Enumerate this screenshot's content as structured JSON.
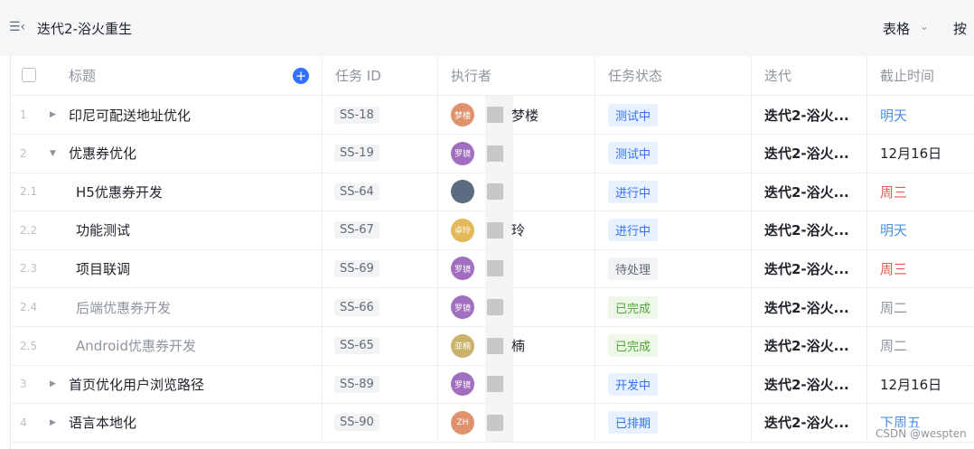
{
  "topbar": {
    "menu_icon": "☰‹",
    "sprint_title": "迭代2-浴火重生",
    "view_label": "表格",
    "view_chevron": "⌄",
    "group_label": "按"
  },
  "columns": {
    "title": "标题",
    "task_id": "任务 ID",
    "assignee": "执行者",
    "status": "任务状态",
    "iteration": "迭代",
    "due": "截止时间"
  },
  "rows": [
    {
      "num": "1",
      "arrow": "▶",
      "title": "印尼可配送地址优化",
      "indent": 0,
      "done": false,
      "id": "SS-18",
      "avatar_text": "梦楼",
      "avatar_color": "#e0926f",
      "assignee": "梦楼",
      "status": "测试中",
      "status_bg": "#e8f1ff",
      "status_fg": "#3370ff",
      "iteration": "迭代2-浴火...",
      "due": "明天",
      "due_color": "#4a90e2"
    },
    {
      "num": "2",
      "arrow": "▼",
      "title": "优惠券优化",
      "indent": 0,
      "done": false,
      "id": "SS-19",
      "avatar_text": "罗镜",
      "avatar_color": "#a16fbf",
      "assignee": "",
      "status": "测试中",
      "status_bg": "#e8f1ff",
      "status_fg": "#3370ff",
      "iteration": "迭代2-浴火...",
      "due": "12月16日",
      "due_color": "#1f2329"
    },
    {
      "num": "2.1",
      "arrow": "",
      "title": "H5优惠券开发",
      "indent": 1,
      "done": false,
      "id": "SS-64",
      "avatar_text": "",
      "avatar_color": "#5a6b82",
      "assignee": "",
      "status": "进行中",
      "status_bg": "#e8f1ff",
      "status_fg": "#3370ff",
      "iteration": "迭代2-浴火...",
      "due": "周三",
      "due_color": "#e05a4f"
    },
    {
      "num": "2.2",
      "arrow": "",
      "title": "功能测试",
      "indent": 1,
      "done": false,
      "id": "SS-67",
      "avatar_text": "卓玲",
      "avatar_color": "#e3b95a",
      "assignee": "玲",
      "status": "进行中",
      "status_bg": "#e8f1ff",
      "status_fg": "#3370ff",
      "iteration": "迭代2-浴火...",
      "due": "明天",
      "due_color": "#4a90e2"
    },
    {
      "num": "2.3",
      "arrow": "",
      "title": "项目联调",
      "indent": 1,
      "done": false,
      "id": "SS-69",
      "avatar_text": "罗镜",
      "avatar_color": "#a16fbf",
      "assignee": "",
      "status": "待处理",
      "status_bg": "#f2f3f5",
      "status_fg": "#646a73",
      "iteration": "迭代2-浴火...",
      "due": "周三",
      "due_color": "#e05a4f"
    },
    {
      "num": "2.4",
      "arrow": "",
      "title": "后端优惠券开发",
      "indent": 1,
      "done": true,
      "id": "SS-66",
      "avatar_text": "罗镜",
      "avatar_color": "#a16fbf",
      "assignee": "",
      "status": "已完成",
      "status_bg": "#eef8e8",
      "status_fg": "#52a33a",
      "iteration": "迭代2-浴火...",
      "due": "周二",
      "due_color": "#8f959e"
    },
    {
      "num": "2.5",
      "arrow": "",
      "title": "Android优惠券开发",
      "indent": 1,
      "done": true,
      "id": "SS-65",
      "avatar_text": "亚楠",
      "avatar_color": "#c9b36a",
      "assignee": "楠",
      "status": "已完成",
      "status_bg": "#eef8e8",
      "status_fg": "#52a33a",
      "iteration": "迭代2-浴火...",
      "due": "周二",
      "due_color": "#8f959e"
    },
    {
      "num": "3",
      "arrow": "▶",
      "title": "首页优化用户浏览路径",
      "indent": 0,
      "done": false,
      "id": "SS-89",
      "avatar_text": "罗镜",
      "avatar_color": "#a16fbf",
      "assignee": "",
      "status": "开发中",
      "status_bg": "#e8f1ff",
      "status_fg": "#3370ff",
      "iteration": "迭代2-浴火...",
      "due": "12月16日",
      "due_color": "#1f2329"
    },
    {
      "num": "4",
      "arrow": "▶",
      "title": "语言本地化",
      "indent": 0,
      "done": false,
      "id": "SS-90",
      "avatar_text": "ZH",
      "avatar_color": "#e0926f",
      "assignee": "",
      "status": "已排期",
      "status_bg": "#e8f1ff",
      "status_fg": "#3370ff",
      "iteration": "迭代2-浴火...",
      "due": "下周五",
      "due_color": "#4a90e2"
    }
  ],
  "watermark": "CSDN @wespten"
}
